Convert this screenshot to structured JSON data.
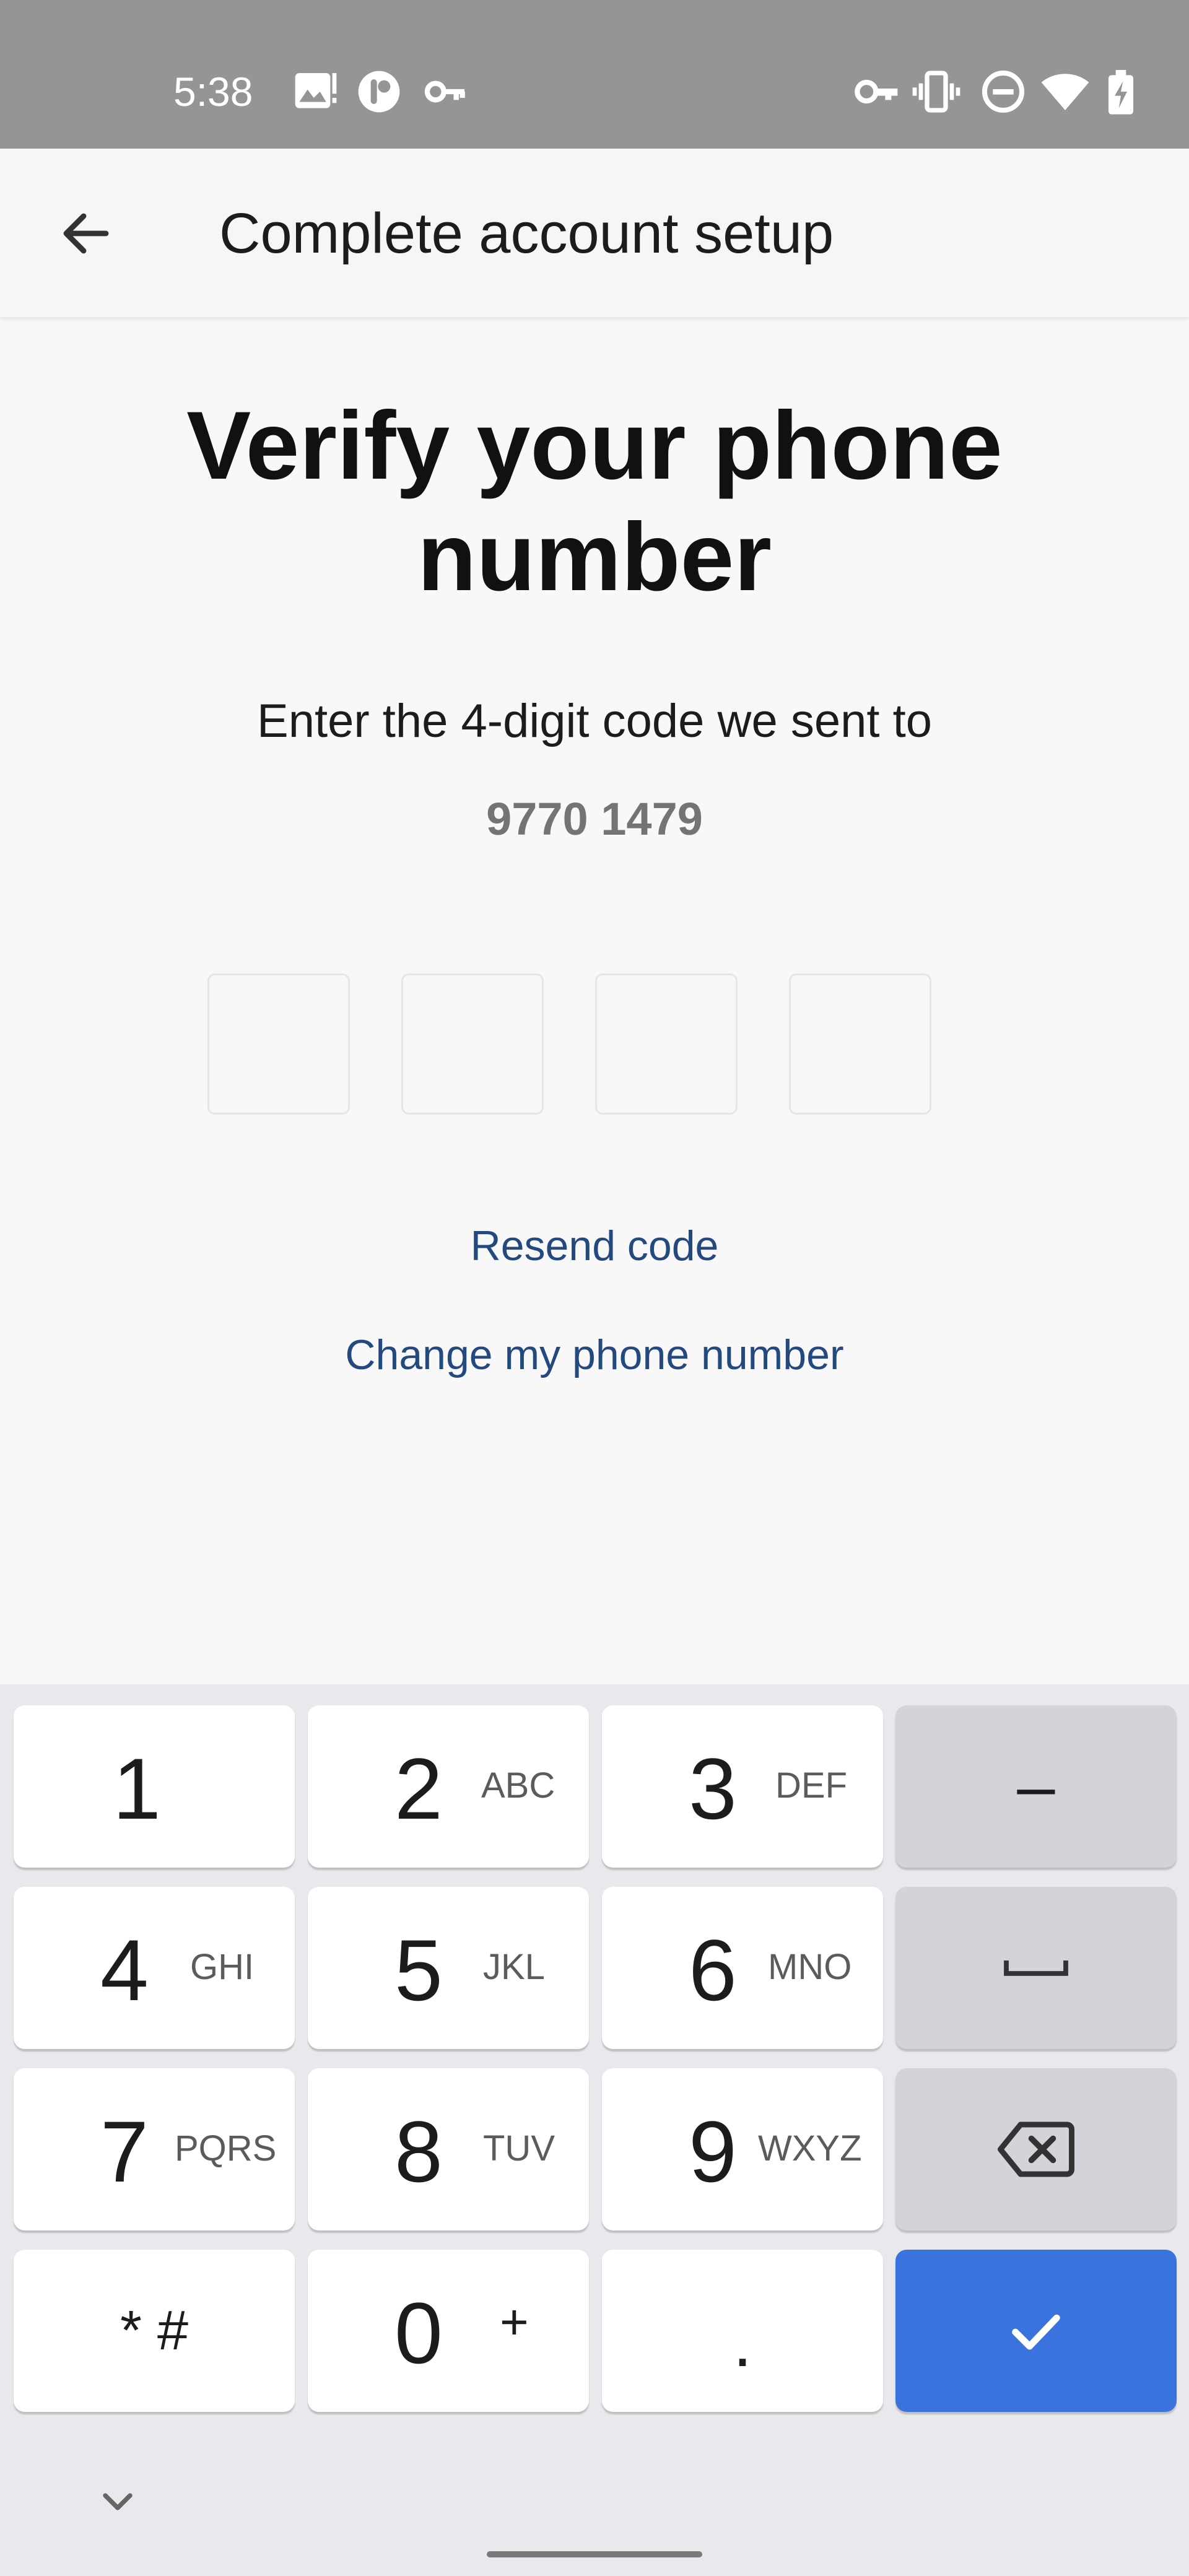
{
  "status_bar": {
    "time": "5:38",
    "left_icons": [
      "image-icon",
      "app-icon",
      "key-icon"
    ],
    "right_icons": [
      "vpn-key-icon",
      "vibrate-icon",
      "do-not-disturb-icon",
      "wifi-icon",
      "battery-charging-icon"
    ]
  },
  "app_bar": {
    "back_icon": "arrow-left-icon",
    "title": "Complete account setup"
  },
  "main": {
    "heading": "Verify your phone number",
    "instruction": "Enter the 4-digit code we sent to",
    "phone_number": "9770 1479",
    "code_inputs": [
      "",
      "",
      "",
      ""
    ],
    "resend_label": "Resend code",
    "change_phone_label": "Change my phone number"
  },
  "keyboard": {
    "keys": {
      "k1": {
        "main": "1",
        "sub": ""
      },
      "k2": {
        "main": "2",
        "sub": "ABC"
      },
      "k3": {
        "main": "3",
        "sub": "DEF"
      },
      "k4": {
        "main": "4",
        "sub": "GHI"
      },
      "k5": {
        "main": "5",
        "sub": "JKL"
      },
      "k6": {
        "main": "6",
        "sub": "MNO"
      },
      "k7": {
        "main": "7",
        "sub": "PQRS"
      },
      "k8": {
        "main": "8",
        "sub": "TUV"
      },
      "k9": {
        "main": "9",
        "sub": "WXYZ"
      },
      "k0": {
        "main": "0",
        "sub": "+"
      },
      "star_hash": "* #",
      "dot": ".",
      "minus": "–"
    },
    "space_icon": "space-bar-icon",
    "backspace_icon": "backspace-icon",
    "done_icon": "checkmark-icon",
    "hide_icon": "chevron-down-icon",
    "accent_color": "#3a73de"
  },
  "colors": {
    "link": "#24497e",
    "phone_number": "#747474",
    "status_bar": "#959595"
  }
}
